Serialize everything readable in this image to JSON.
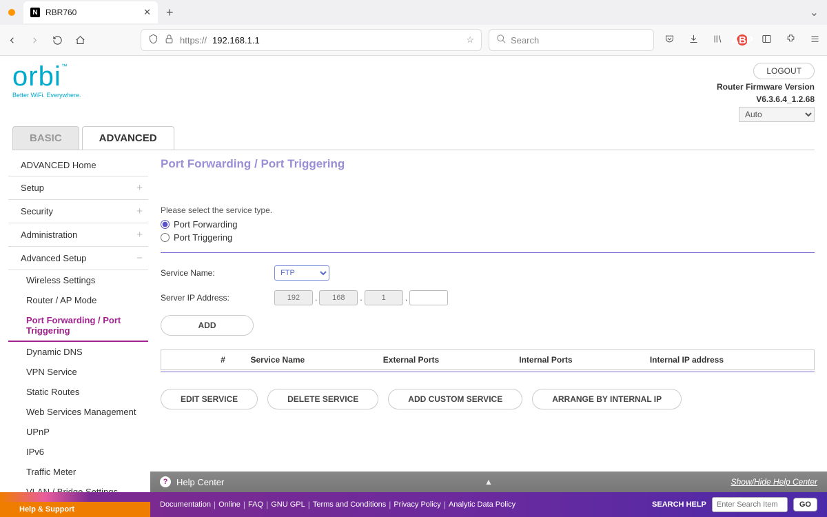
{
  "browser": {
    "tab_title": "RBR760",
    "url_scheme": "https://",
    "url_host": "192.168.1.1",
    "search_placeholder": "Search"
  },
  "header": {
    "logo": "orbi",
    "tagline": "Better WiFi. Everywhere.",
    "logout": "LOGOUT",
    "fw_label": "Router Firmware Version",
    "fw_version": "V6.3.6.4_1.2.68",
    "language": "Auto"
  },
  "main_tabs": {
    "basic": "BASIC",
    "advanced": "ADVANCED"
  },
  "sidebar": {
    "top": [
      {
        "label": "ADVANCED Home",
        "expand": ""
      },
      {
        "label": "Setup",
        "expand": "+"
      },
      {
        "label": "Security",
        "expand": "+"
      },
      {
        "label": "Administration",
        "expand": "+"
      },
      {
        "label": "Advanced Setup",
        "expand": "−"
      }
    ],
    "sub": [
      "Wireless Settings",
      "Router / AP Mode",
      "Port Forwarding / Port Triggering",
      "Dynamic DNS",
      "VPN Service",
      "Static Routes",
      "Web Services Management",
      "UPnP",
      "IPv6",
      "Traffic Meter",
      "VLAN / Bridge Settings"
    ],
    "active_sub_index": 2
  },
  "content": {
    "title": "Port Forwarding / Port Triggering",
    "instruction": "Please select the service type.",
    "radio_forwarding": "Port Forwarding",
    "radio_triggering": "Port Triggering",
    "service_name_label": "Service Name:",
    "service_name_value": "FTP",
    "server_ip_label": "Server IP Address:",
    "ip_octets": [
      "192",
      "168",
      "1",
      ""
    ],
    "add_btn": "ADD",
    "table_headers": [
      "",
      "#",
      "Service Name",
      "External Ports",
      "Internal Ports",
      "Internal IP address"
    ],
    "actions": {
      "edit": "EDIT SERVICE",
      "delete": "DELETE SERVICE",
      "custom": "ADD CUSTOM SERVICE",
      "arrange": "ARRANGE BY INTERNAL IP"
    }
  },
  "help_center": {
    "title": "Help Center",
    "toggle": "Show/Hide Help Center"
  },
  "footer": {
    "hs": "Help & Support",
    "links": [
      "Documentation",
      "Online",
      "FAQ",
      "GNU GPL",
      "Terms and Conditions",
      "Privacy Policy",
      "Analytic Data Policy"
    ],
    "search_label": "SEARCH HELP",
    "search_placeholder": "Enter Search Item",
    "go": "GO"
  }
}
